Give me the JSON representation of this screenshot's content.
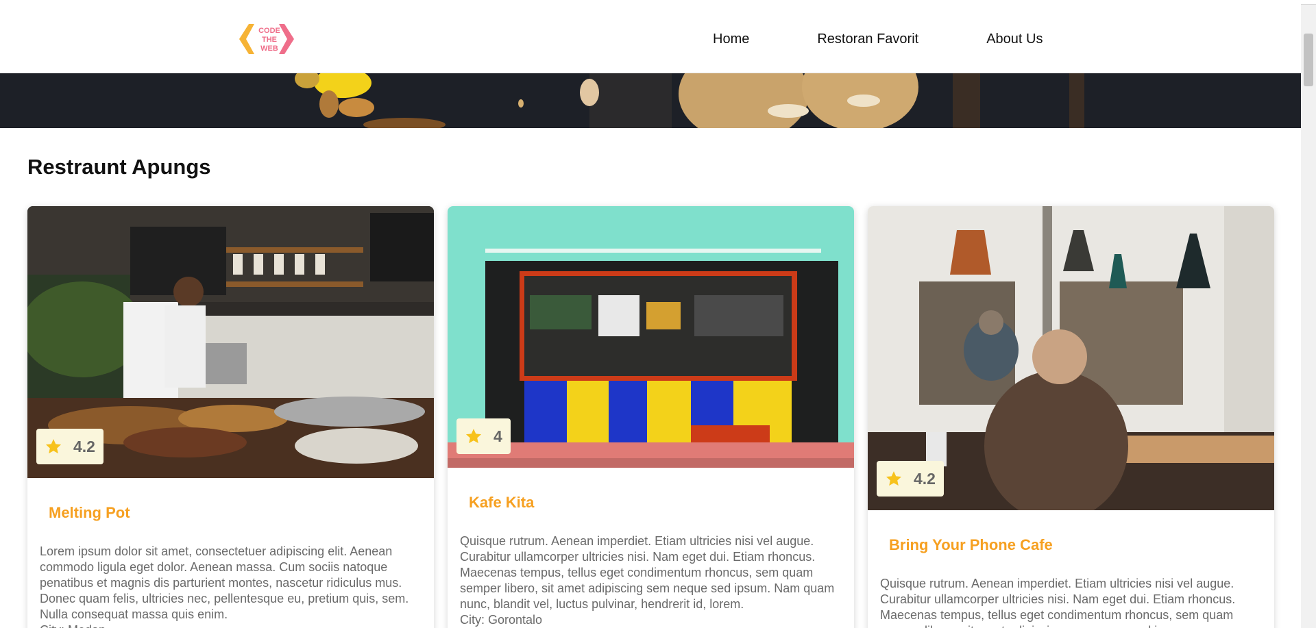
{
  "header": {
    "logo_text": [
      "CODE",
      "THE",
      "WEB"
    ],
    "nav": [
      {
        "label": "Home"
      },
      {
        "label": "Restoran Favorit"
      },
      {
        "label": "About Us"
      }
    ]
  },
  "section_title": "Restraunt Apungs",
  "restaurants": [
    {
      "name": "Melting Pot",
      "rating": "4.2",
      "description": "Lorem ipsum dolor sit amet, consectetuer adipiscing elit. Aenean commodo ligula eget dolor. Aenean massa. Cum sociis natoque penatibus et magnis dis parturient montes, nascetur ridiculus mus. Donec quam felis, ultricies nec, pellentesque eu, pretium quis, sem. Nulla consequat massa quis enim.",
      "city": "City: Medan"
    },
    {
      "name": "Kafe Kita",
      "rating": "4",
      "description": "Quisque rutrum. Aenean imperdiet. Etiam ultricies nisi vel augue. Curabitur ullamcorper ultricies nisi. Nam eget dui. Etiam rhoncus. Maecenas tempus, tellus eget condimentum rhoncus, sem quam semper libero, sit amet adipiscing sem neque sed ipsum. Nam quam nunc, blandit vel, luctus pulvinar, hendrerit id, lorem.",
      "city": "City: Gorontalo"
    },
    {
      "name": "Bring Your Phone Cafe",
      "rating": "4.2",
      "description": "Quisque rutrum. Aenean imperdiet. Etiam ultricies nisi vel augue. Curabitur ullamcorper ultricies nisi. Nam eget dui. Etiam rhoncus. Maecenas tempus, tellus eget condimentum rhoncus, sem quam semper libero, sit amet adipiscing sem neque sed ipsum.",
      "city": ""
    }
  ],
  "colors": {
    "accent": "#f6a021",
    "rating_bg": "#faf6dc",
    "star": "#f7c21b"
  },
  "icons": {
    "logo": "code-the-web-logo",
    "rating": "star-icon"
  }
}
